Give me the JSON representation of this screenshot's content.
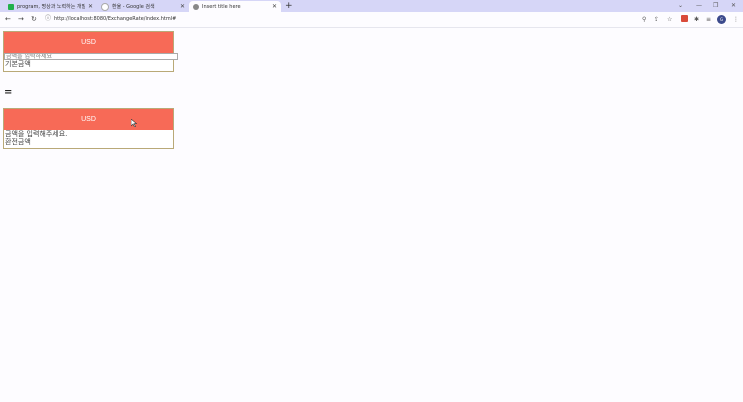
{
  "browser": {
    "tabs": [
      {
        "label": "program, 명상과 노력하는 개발",
        "favicon_color": "#22b14c"
      },
      {
        "label": "환율 - Google 검색",
        "favicon_color": "#cccccc"
      },
      {
        "label": "Insert title here",
        "favicon_color": "#888888"
      }
    ],
    "active_tab": 2,
    "new_tab": "+",
    "url": "http://localhost:8080/ExchangeRate/index.html#",
    "profile_initials": "G"
  },
  "converter": {
    "from": {
      "currency": "USD",
      "input_placeholder": "금액을 입력하세요",
      "caption": "기본금액"
    },
    "equals": "=",
    "to": {
      "currency": "USD",
      "result_text": "금액을 입력해주세요.",
      "caption": "환전금액"
    }
  },
  "colors": {
    "accent": "#f76a57",
    "border": "#b9a977"
  }
}
